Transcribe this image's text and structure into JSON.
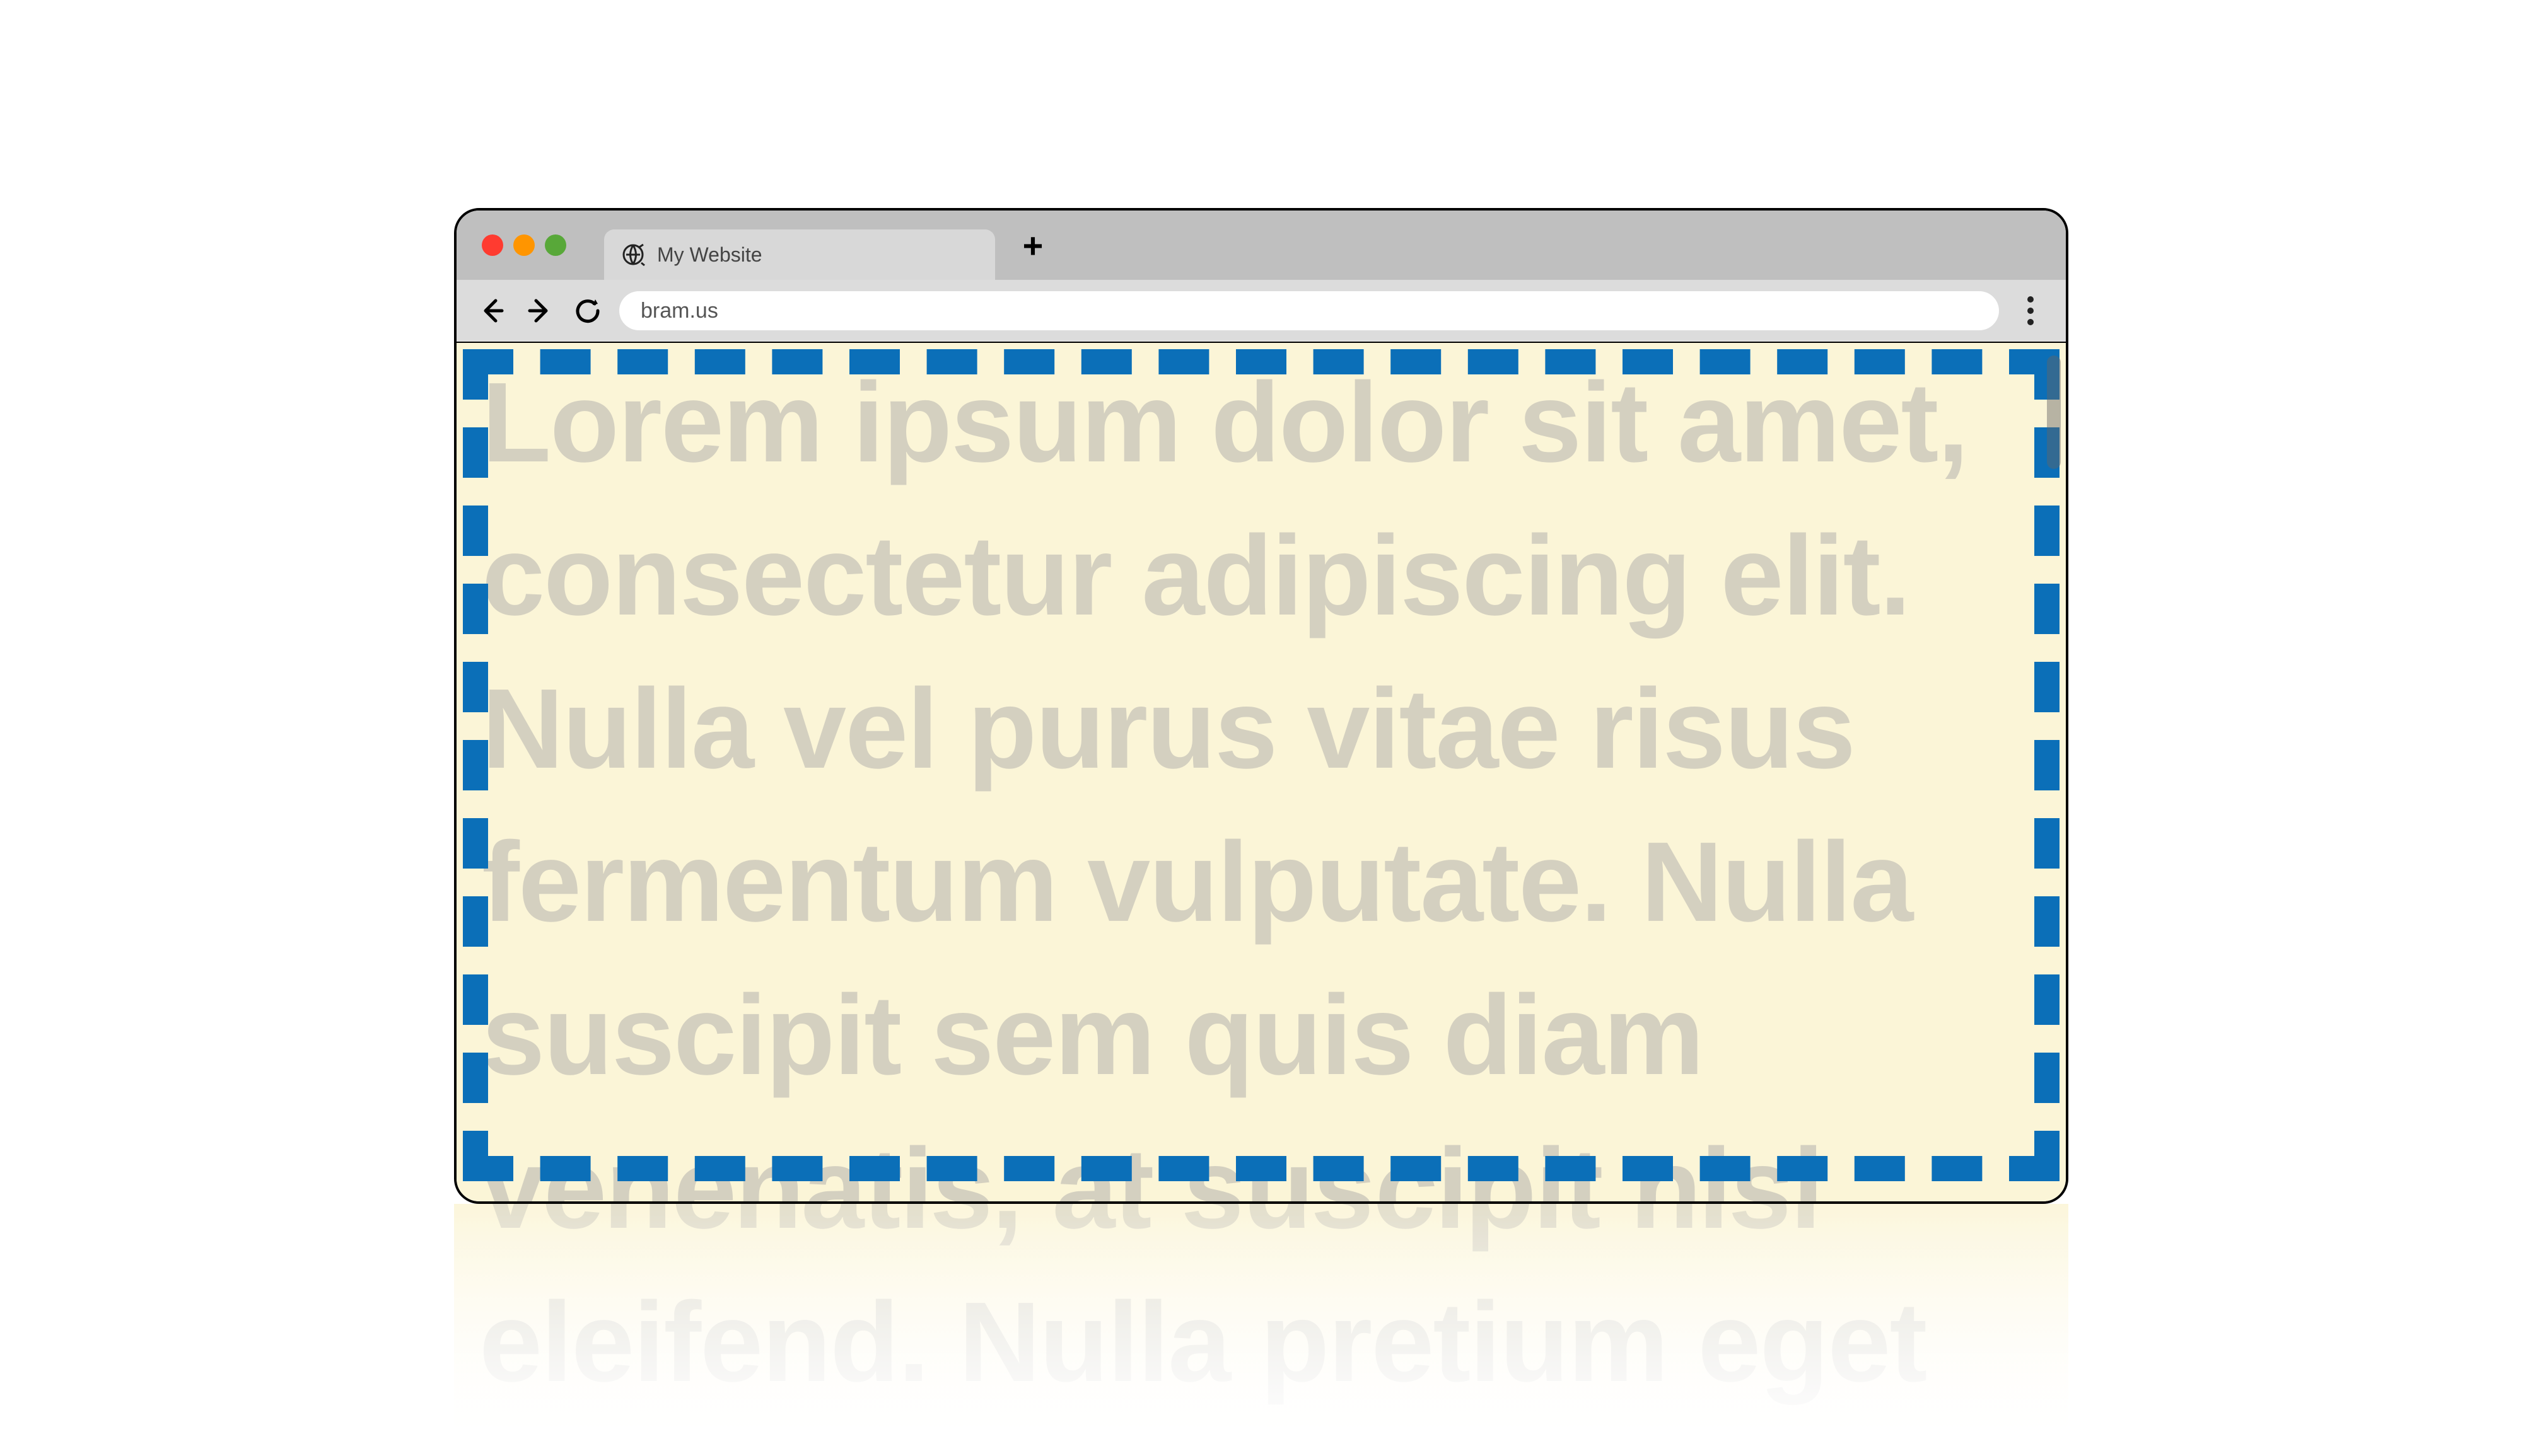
{
  "browser": {
    "tab_title": "My Website",
    "url": "bram.us"
  },
  "page": {
    "body_text": "Lorem ipsum dolor sit amet, consectetur adipiscing elit. Nulla vel purus vitae risus fermentum vulputate. Nulla suscipit sem quis diam venenatis, at suscipit nisl eleifend. Nulla pretium eget"
  },
  "colors": {
    "page_bg": "#fbf5d7",
    "dashed_border": "#0b6fb8",
    "text_watermark": "rgba(140,140,150,0.35)"
  }
}
